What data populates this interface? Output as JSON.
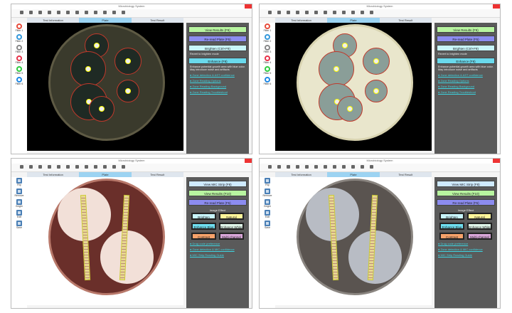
{
  "window_title": "Microbiology System",
  "tabs": [
    "Test Information",
    "Plate",
    "Test Result"
  ],
  "filters": [
    "Filter 1",
    "Filter 2",
    "Filter 3",
    "Filter 4",
    "Filter 5",
    "Filter 6"
  ],
  "filter_colors": [
    "#e74c3c",
    "#3498db",
    "#888888",
    "#e8334a",
    "#2ecc40",
    "#1e88e5"
  ],
  "disk_tools": [
    "Flip",
    "Remove",
    "Bright",
    "Edit",
    "Save"
  ],
  "disk_panel": {
    "view_results": "View Results (F9)",
    "reread": "Re-read Plate (F5)",
    "brighten": "Brighten (Ctrl+F9)",
    "brighten_note": "Revert to brighten mode",
    "enhance": "Enhance (F8)",
    "enhance_note": "Enhance potential growth area with blue color. May introduce noise and artifacts",
    "links": [
      "Zone detection & AST confidence",
      "Zone Reading Options",
      "Zone Reading Background",
      "Zone Reading Troubleshoot"
    ]
  },
  "mic_panel": {
    "view_mic": "View MIC Strip (F8)",
    "view_results": "View Results (F10)",
    "reread": "Re-read Plate (F5)",
    "effects_title": "Image Effect",
    "effects": [
      "Brighten",
      "Natural",
      "Enhance Blue",
      "Enhance White",
      "Contrast",
      "Multi-channel"
    ],
    "effect_colors": [
      "#c8f4fb",
      "#fff59a",
      "#6fdff0",
      "#dff5e8",
      "#f6a26a",
      "#d9a6d9"
    ],
    "links": [
      "Drug code preference",
      "Zone detection & MIC confidence",
      "MIC Strip Reading Guide"
    ]
  },
  "panels": [
    {
      "type": "disk",
      "plate": "#3a3a2c",
      "agar": "#5e5a44",
      "zone": "#1f2a24"
    },
    {
      "type": "disk",
      "plate": "#e9e6cc",
      "agar": "#d8d3b0",
      "zone": "#8a9e98"
    },
    {
      "type": "mic",
      "plate": "#6a2f2a",
      "agar": "#b8786a",
      "zone": "#f2e0d8"
    },
    {
      "type": "mic",
      "plate": "#5a5450",
      "agar": "#8a8580",
      "zone": "#b8bcc4"
    }
  ]
}
